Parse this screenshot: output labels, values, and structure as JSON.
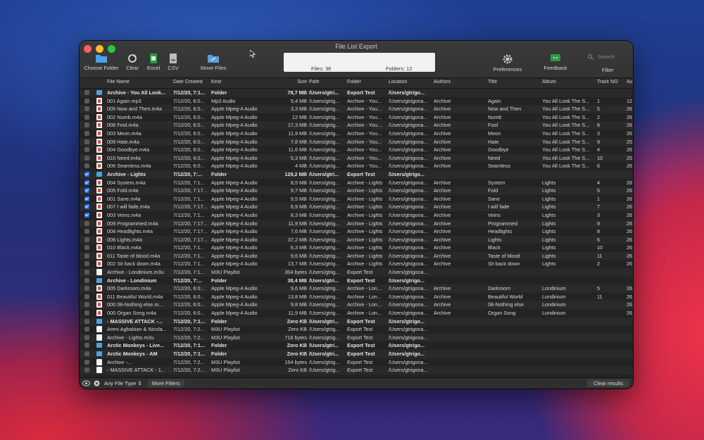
{
  "window": {
    "title": "File List Export"
  },
  "toolbar": {
    "choose_folder": "Choose Folder",
    "clear": "Clear",
    "excel": "Excel",
    "csv": "CSV",
    "move_files": "Move Files",
    "preferences": "Preferences",
    "feedback": "Feedback",
    "filter": "Filter"
  },
  "status": {
    "files": "Files: 36",
    "folders": "Folders: 12"
  },
  "search": {
    "placeholder": "Search"
  },
  "columns": [
    "File Name",
    "Date Created",
    "Kind",
    "Size",
    "Path",
    "Folder",
    "Location",
    "Authors",
    "Title",
    "Album",
    "Track NO",
    "Au"
  ],
  "rows": [
    {
      "check": "off",
      "icon": "folder",
      "bold": true,
      "name": "Archive - You All Look...",
      "date": "7/12/20, 7:1...",
      "kind": "Folder",
      "size": "78,7 MB",
      "path": "/Users/gtri...",
      "folder": "Export Test",
      "location": "/Users/gtrigo...",
      "authors": "",
      "title": "",
      "album": "",
      "track": "",
      "au": ""
    },
    {
      "check": "off",
      "icon": "audio",
      "bold": false,
      "name": "001 Again.mp3",
      "date": "7/12/20, 6:0...",
      "kind": "Mp3 Audio",
      "size": "5,4 MB",
      "path": "/Users/gtrig...",
      "folder": "Archive - You...",
      "location": "/Users/gtrigona...",
      "authors": "Archive",
      "title": "Again",
      "album": "You All Look The S...",
      "track": "1",
      "au": "12"
    },
    {
      "check": "off",
      "icon": "audio",
      "bold": false,
      "name": "005 Now and Then.m4a",
      "date": "7/12/20, 6:0...",
      "kind": "Apple Mpeg-4 Audio",
      "size": "3,3 MB",
      "path": "/Users/gtrig...",
      "folder": "Archive - You...",
      "location": "/Users/gtrigona...",
      "authors": "Archive",
      "title": "Now and Then",
      "album": "You All Look The S...",
      "track": "5",
      "au": "26"
    },
    {
      "check": "off",
      "icon": "audio",
      "bold": false,
      "name": "002 Numb.m4a",
      "date": "7/12/20, 6:0...",
      "kind": "Apple Mpeg-4 Audio",
      "size": "12 MB",
      "path": "/Users/gtrig...",
      "folder": "Archive - You...",
      "location": "/Users/gtrigona...",
      "authors": "Archive",
      "title": "Numb",
      "album": "You All Look The S...",
      "track": "2",
      "au": "26"
    },
    {
      "check": "off",
      "icon": "audio",
      "bold": false,
      "name": "008 Fool.m4a",
      "date": "7/12/20, 6:0...",
      "kind": "Apple Mpeg-4 Audio",
      "size": "17,3 MB",
      "path": "/Users/gtrig...",
      "folder": "Archive - You...",
      "location": "/Users/gtrigona...",
      "authors": "Archive",
      "title": "Fool",
      "album": "You All Look The S...",
      "track": "8",
      "au": "26"
    },
    {
      "check": "off",
      "icon": "audio",
      "bold": false,
      "name": "003 Meon.m4a",
      "date": "7/12/20, 6:0...",
      "kind": "Apple Mpeg-4 Audio",
      "size": "11,9 MB",
      "path": "/Users/gtrig...",
      "folder": "Archive - You...",
      "location": "/Users/gtrigona...",
      "authors": "Archive",
      "title": "Meon",
      "album": "You All Look The S...",
      "track": "3",
      "au": "26"
    },
    {
      "check": "off",
      "icon": "audio",
      "bold": false,
      "name": "009 Hate.m4a",
      "date": "7/12/20, 6:0...",
      "kind": "Apple Mpeg-4 Audio",
      "size": "7,8 MB",
      "path": "/Users/gtrig...",
      "folder": "Archive - You...",
      "location": "/Users/gtrigona...",
      "authors": "Archive",
      "title": "Hate",
      "album": "You All Look The S...",
      "track": "9",
      "au": "25"
    },
    {
      "check": "off",
      "icon": "audio",
      "bold": false,
      "name": "004 Goodbye.m4a",
      "date": "7/12/20, 6:0...",
      "kind": "Apple Mpeg-4 Audio",
      "size": "11,6 MB",
      "path": "/Users/gtrig...",
      "folder": "Archive - You...",
      "location": "/Users/gtrigona...",
      "authors": "Archive",
      "title": "Goodbye",
      "album": "You All Look The S...",
      "track": "4",
      "au": "26"
    },
    {
      "check": "off",
      "icon": "audio",
      "bold": false,
      "name": "010 Need.m4a",
      "date": "7/12/20, 6:0...",
      "kind": "Apple Mpeg-4 Audio",
      "size": "5,3 MB",
      "path": "/Users/gtrig...",
      "folder": "Archive - You...",
      "location": "/Users/gtrigona...",
      "authors": "Archive",
      "title": "Need",
      "album": "You All Look The S...",
      "track": "10",
      "au": "25"
    },
    {
      "check": "off",
      "icon": "audio",
      "bold": false,
      "name": "006 Seamless.m4a",
      "date": "7/12/20, 6:0...",
      "kind": "Apple Mpeg-4 Audio",
      "size": "4 MB",
      "path": "/Users/gtrig...",
      "folder": "Archive - You...",
      "location": "/Users/gtrigona...",
      "authors": "Archive",
      "title": "Seamless",
      "album": "You All Look The S...",
      "track": "6",
      "au": "26"
    },
    {
      "check": "on",
      "icon": "folder",
      "bold": true,
      "name": "Archive - Lights",
      "date": "7/12/20, 7:...",
      "kind": "Folder",
      "size": "129,2 MB",
      "path": "/Users/gtri...",
      "folder": "Export Test",
      "location": "/Users/gtrigo...",
      "authors": "",
      "title": "",
      "album": "",
      "track": "",
      "au": ""
    },
    {
      "check": "on",
      "icon": "audio",
      "bold": false,
      "name": "004 System.m4a",
      "date": "7/12/20, 7:1...",
      "kind": "Apple Mpeg-4 Audio",
      "size": "8,5 MB",
      "path": "/Users/gtrig...",
      "folder": "Archive - Lights",
      "location": "/Users/gtrigona...",
      "authors": "Archive",
      "title": "System",
      "album": "Lights",
      "track": "4",
      "au": "26"
    },
    {
      "check": "on",
      "icon": "audio",
      "bold": false,
      "name": "005 Fold.m4a",
      "date": "7/12/20, 7:17...",
      "kind": "Apple Mpeg-4 Audio",
      "size": "9,7 MB",
      "path": "/Users/gtrig...",
      "folder": "Archive - Lights",
      "location": "/Users/gtrigona...",
      "authors": "Archive",
      "title": "Fold",
      "album": "Lights",
      "track": "5",
      "au": "26"
    },
    {
      "check": "on",
      "icon": "audio",
      "bold": false,
      "name": "001 Sane.m4a",
      "date": "7/12/20, 7:1...",
      "kind": "Apple Mpeg-4 Audio",
      "size": "9,5 MB",
      "path": "/Users/gtrig...",
      "folder": "Archive - Lights",
      "location": "/Users/gtrigona...",
      "authors": "Archive",
      "title": "Sane",
      "album": "Lights",
      "track": "1",
      "au": "26"
    },
    {
      "check": "on",
      "icon": "audio",
      "bold": false,
      "name": "007 I will fade.m4a",
      "date": "7/12/20, 7:17...",
      "kind": "Apple Mpeg-4 Audio",
      "size": "6,9 MB",
      "path": "/Users/gtrig...",
      "folder": "Archive - Lights",
      "location": "/Users/gtrigona...",
      "authors": "Archive",
      "title": "I will fade",
      "album": "Lights",
      "track": "7",
      "au": "26"
    },
    {
      "check": "on",
      "icon": "audio",
      "bold": false,
      "name": "003 Veins.m4a",
      "date": "7/12/20, 7:1...",
      "kind": "Apple Mpeg-4 Audio",
      "size": "8,3 MB",
      "path": "/Users/gtrig...",
      "folder": "Archive - Lights",
      "location": "/Users/gtrigona...",
      "authors": "Archive",
      "title": "Veins",
      "album": "Lights",
      "track": "3",
      "au": "26"
    },
    {
      "check": "off",
      "icon": "audio",
      "bold": false,
      "name": "009 Programmed.m4a",
      "date": "7/12/20, 7:17...",
      "kind": "Apple Mpeg-4 Audio",
      "size": "11,9 MB",
      "path": "/Users/gtrig...",
      "folder": "Archive - Lights",
      "location": "/Users/gtrigona...",
      "authors": "Archive",
      "title": "Programmed",
      "album": "Lights",
      "track": "9",
      "au": "26"
    },
    {
      "check": "off",
      "icon": "audio",
      "bold": false,
      "name": "008 Headlights.m4a",
      "date": "7/12/20, 7:17...",
      "kind": "Apple Mpeg-4 Audio",
      "size": "7,6 MB",
      "path": "/Users/gtrig...",
      "folder": "Archive - Lights",
      "location": "/Users/gtrigona...",
      "authors": "Archive",
      "title": "Headlights",
      "album": "Lights",
      "track": "8",
      "au": "26"
    },
    {
      "check": "off",
      "icon": "audio",
      "bold": false,
      "name": "006 Lights.m4a",
      "date": "7/12/20, 7:17...",
      "kind": "Apple Mpeg-4 Audio",
      "size": "37,2 MB",
      "path": "/Users/gtrig...",
      "folder": "Archive - Lights",
      "location": "/Users/gtrigona...",
      "authors": "Archive",
      "title": "Lights",
      "album": "Lights",
      "track": "6",
      "au": "26"
    },
    {
      "check": "off",
      "icon": "audio",
      "bold": false,
      "name": "010 Black.m4a",
      "date": "7/12/20, 7:1...",
      "kind": "Apple Mpeg-4 Audio",
      "size": "6,3 MB",
      "path": "/Users/gtrig...",
      "folder": "Archive - Lights",
      "location": "/Users/gtrigona...",
      "authors": "Archive",
      "title": "Black",
      "album": "Lights",
      "track": "10",
      "au": "26"
    },
    {
      "check": "off",
      "icon": "audio",
      "bold": false,
      "name": "011 Taste of blood.m4a",
      "date": "7/12/20, 7:1...",
      "kind": "Apple Mpeg-4 Audio",
      "size": "9,6 MB",
      "path": "/Users/gtrig...",
      "folder": "Archive - Lights",
      "location": "/Users/gtrigona...",
      "authors": "Archive",
      "title": "Taste of blood",
      "album": "Lights",
      "track": "11",
      "au": "26"
    },
    {
      "check": "off",
      "icon": "audio",
      "bold": false,
      "name": "002 Sit back down.m4a",
      "date": "7/12/20, 7:1...",
      "kind": "Apple Mpeg-4 Audio",
      "size": "13,7 MB",
      "path": "/Users/gtrig...",
      "folder": "Archive - Lights",
      "location": "/Users/gtrigona...",
      "authors": "Archive",
      "title": "Sit back down",
      "album": "Lights",
      "track": "2",
      "au": "26"
    },
    {
      "check": "off",
      "icon": "list",
      "bold": false,
      "name": "Archive - Londinium.m3u",
      "date": "7/12/20, 7:1...",
      "kind": "M3U Playlist",
      "size": "304 bytes",
      "path": "/Users/gtrig...",
      "folder": "Export Test",
      "location": "/Users/gtrigona...",
      "authors": "",
      "title": "",
      "album": "",
      "track": "",
      "au": ""
    },
    {
      "check": "off",
      "icon": "folder",
      "bold": true,
      "name": "Archive - Londinium",
      "date": "7/12/20, 7:...",
      "kind": "Folder",
      "size": "38,4 MB",
      "path": "/Users/gtri...",
      "folder": "Export Test",
      "location": "/Users/gtrigo...",
      "authors": "",
      "title": "",
      "album": "",
      "track": "",
      "au": ""
    },
    {
      "check": "off",
      "icon": "audio",
      "bold": false,
      "name": "005 Darkroom.m4a",
      "date": "7/12/20, 6:0...",
      "kind": "Apple Mpeg-4 Audio",
      "size": "9,6 MB",
      "path": "/Users/gtrig...",
      "folder": "Archive - Lon...",
      "location": "/Users/gtrigona...",
      "authors": "Archive",
      "title": "Darkroom",
      "album": "Londinium",
      "track": "5",
      "au": "26"
    },
    {
      "check": "off",
      "icon": "audio",
      "bold": false,
      "name": "011 Beautiful World.m4a",
      "date": "7/12/20, 6:0...",
      "kind": "Apple Mpeg-4 Audio",
      "size": "13,8 MB",
      "path": "/Users/gtrig...",
      "folder": "Archive - Lon...",
      "location": "/Users/gtrigona...",
      "authors": "Archive",
      "title": "Beautiful World",
      "album": "Londinium",
      "track": "11",
      "au": "26"
    },
    {
      "check": "off",
      "icon": "audio",
      "bold": false,
      "name": "000 08-Nothing else.m...",
      "date": "7/12/20, 6:0...",
      "kind": "Apple Mpeg-4 Audio",
      "size": "9,8 MB",
      "path": "/Users/gtrig...",
      "folder": "Archive - Lon...",
      "location": "/Users/gtrigona...",
      "authors": "Archive",
      "title": "08-Nothing else",
      "album": "Londinium",
      "track": "",
      "au": "26"
    },
    {
      "check": "off",
      "icon": "audio",
      "bold": false,
      "name": "000 Organ Song.m4a",
      "date": "7/12/20, 6:0...",
      "kind": "Apple Mpeg-4 Audio",
      "size": "11,9 MB",
      "path": "/Users/gtrig...",
      "folder": "Archive - Lon...",
      "location": "/Users/gtrigona...",
      "authors": "Archive",
      "title": "Organ Song",
      "album": "Londinium",
      "track": "",
      "au": "26"
    },
    {
      "check": "off",
      "icon": "folder",
      "bold": true,
      "name": "- MASSIVE ATTACK -...",
      "date": "7/12/20, 7:1...",
      "kind": "Folder",
      "size": "Zero KB",
      "path": "/Users/gtri...",
      "folder": "Export Test",
      "location": "/Users/gtrigo...",
      "authors": "",
      "title": "",
      "album": "",
      "track": "",
      "au": ""
    },
    {
      "check": "off",
      "icon": "list",
      "bold": false,
      "name": "Areni Agbabian & Nicola...",
      "date": "7/12/20, 7:2...",
      "kind": "M3U Playlist",
      "size": "Zero KB",
      "path": "/Users/gtrig...",
      "folder": "Export Test",
      "location": "/Users/gtrigona...",
      "authors": "",
      "title": "",
      "album": "",
      "track": "",
      "au": ""
    },
    {
      "check": "off",
      "icon": "list",
      "bold": false,
      "name": "Archive - Lights.m3u",
      "date": "7/12/20, 7:2...",
      "kind": "M3U Playlist",
      "size": "716 bytes",
      "path": "/Users/gtrig...",
      "folder": "Export Test",
      "location": "/Users/gtrigona...",
      "authors": "",
      "title": "",
      "album": "",
      "track": "",
      "au": ""
    },
    {
      "check": "off",
      "icon": "folder",
      "bold": true,
      "name": "Arctic Monkeys - Live...",
      "date": "7/12/20, 7:1...",
      "kind": "Folder",
      "size": "Zero KB",
      "path": "/Users/gtri...",
      "folder": "Export Test",
      "location": "/Users/gtrigo...",
      "authors": "",
      "title": "",
      "album": "",
      "track": "",
      "au": ""
    },
    {
      "check": "off",
      "icon": "folder",
      "bold": true,
      "name": "Arctic Monkeys - AM",
      "date": "7/12/20, 7:1...",
      "kind": "Folder",
      "size": "Zero KB",
      "path": "/Users/gtri...",
      "folder": "Export Test",
      "location": "/Users/gtrigo...",
      "authors": "",
      "title": "",
      "album": "",
      "track": "",
      "au": ""
    },
    {
      "check": "off",
      "icon": "list",
      "bold": false,
      "name": "Archive            -...",
      "date": "7/12/20, 7:2...",
      "kind": "M3U Playlist",
      "size": "154 bytes",
      "path": "/Users/gtrig...",
      "folder": "Export Test",
      "location": "/Users/gtrigona...",
      "authors": "",
      "title": "",
      "album": "",
      "track": "",
      "au": ""
    },
    {
      "check": "off",
      "icon": "list",
      "bold": false,
      "name": "- MASSIVE ATTACK - 1...",
      "date": "7/12/20, 7:2...",
      "kind": "M3U Playlist",
      "size": "Zero KB",
      "path": "/Users/gtrig...",
      "folder": "Export Test",
      "location": "/Users/gtrigona...",
      "authors": "",
      "title": "",
      "album": "",
      "track": "",
      "au": ""
    }
  ],
  "footer": {
    "file_type": "Any File Type",
    "more_filters": "More Filters",
    "clear_results": "Clear results"
  },
  "colors": {
    "accent": "#1e6cf0",
    "folder": "#4aa3e8",
    "close": "#ff5f57",
    "minimize": "#febc2e",
    "zoom": "#28c840"
  }
}
